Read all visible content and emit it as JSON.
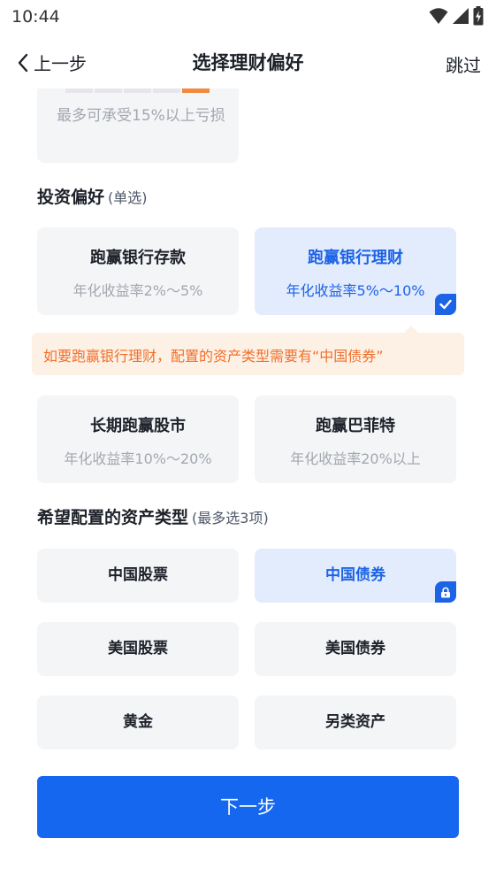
{
  "status_bar": {
    "time": "10:44"
  },
  "nav": {
    "back_label": "上一步",
    "title": "选择理财偏好",
    "skip_label": "跳过"
  },
  "risk_card": {
    "text": "最多可承受15%以上亏损",
    "active_level": 5,
    "levels": 5
  },
  "investment_preference": {
    "title": "投资偏好",
    "hint": "(单选)",
    "options": [
      {
        "title": "跑赢银行存款",
        "subtitle": "年化收益率2%～5%",
        "selected": false
      },
      {
        "title": "跑赢银行理财",
        "subtitle": "年化收益率5%～10%",
        "selected": true
      },
      {
        "title": "长期跑赢股市",
        "subtitle": "年化收益率10%～20%",
        "selected": false
      },
      {
        "title": "跑赢巴菲特",
        "subtitle": "年化收益率20%以上",
        "selected": false
      }
    ],
    "tip": "如要跑赢银行理财，配置的资产类型需要有“中国债券”"
  },
  "asset_types": {
    "title": "希望配置的资产类型",
    "hint": "(最多选3项)",
    "options": [
      {
        "label": "中国股票",
        "selected": false
      },
      {
        "label": "中国债券",
        "selected": true,
        "locked": true
      },
      {
        "label": "美国股票",
        "selected": false
      },
      {
        "label": "美国债券",
        "selected": false
      },
      {
        "label": "黄金",
        "selected": false
      },
      {
        "label": "另类资产",
        "selected": false
      }
    ]
  },
  "next_button": {
    "label": "下一步"
  },
  "colors": {
    "accent": "#1567f0",
    "selected_bg": "#e3ecfd",
    "warning": "#f26f2a",
    "card_bg": "#f4f5f7",
    "risk_active": "#f08a3e"
  }
}
